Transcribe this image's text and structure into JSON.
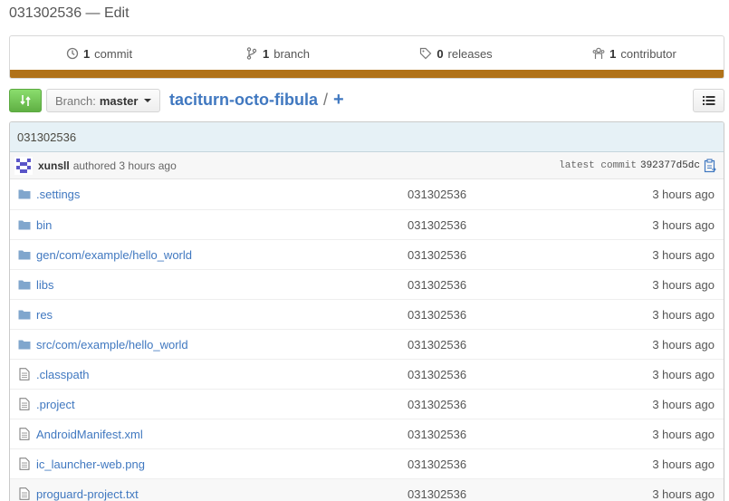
{
  "page": {
    "title": "031302536 — Edit"
  },
  "summary": {
    "commits": {
      "count": "1",
      "label": "commit"
    },
    "branches": {
      "count": "1",
      "label": "branch"
    },
    "releases": {
      "count": "0",
      "label": "releases"
    },
    "contributors": {
      "count": "1",
      "label": "contributor"
    },
    "language_color": "#b07219"
  },
  "toolbar": {
    "branch_label": "Branch:",
    "branch_name": "master",
    "repo_name": "taciturn-octo-fibula",
    "separator": "/",
    "plus": "+"
  },
  "commit": {
    "message": "031302536",
    "author": "xunsll",
    "authored_text": "authored 3 hours ago",
    "latest_label": "latest commit",
    "sha": "392377d5dc"
  },
  "files": [
    {
      "type": "dir",
      "prefix": "",
      "name": ".settings",
      "message": "031302536",
      "age": "3 hours ago"
    },
    {
      "type": "dir",
      "prefix": "",
      "name": "bin",
      "message": "031302536",
      "age": "3 hours ago"
    },
    {
      "type": "dir",
      "prefix": "gen/com/example/",
      "name": "hello_world",
      "message": "031302536",
      "age": "3 hours ago"
    },
    {
      "type": "dir",
      "prefix": "",
      "name": "libs",
      "message": "031302536",
      "age": "3 hours ago"
    },
    {
      "type": "dir",
      "prefix": "",
      "name": "res",
      "message": "031302536",
      "age": "3 hours ago"
    },
    {
      "type": "dir",
      "prefix": "src/com/example/",
      "name": "hello_world",
      "message": "031302536",
      "age": "3 hours ago"
    },
    {
      "type": "file",
      "prefix": "",
      "name": ".classpath",
      "message": "031302536",
      "age": "3 hours ago"
    },
    {
      "type": "file",
      "prefix": "",
      "name": ".project",
      "message": "031302536",
      "age": "3 hours ago"
    },
    {
      "type": "file",
      "prefix": "",
      "name": "AndroidManifest.xml",
      "message": "031302536",
      "age": "3 hours ago"
    },
    {
      "type": "file",
      "prefix": "",
      "name": "ic_launcher-web.png",
      "message": "031302536",
      "age": "3 hours ago"
    },
    {
      "type": "file",
      "prefix": "",
      "name": "proguard-project.txt",
      "message": "031302536",
      "age": "3 hours ago"
    }
  ]
}
